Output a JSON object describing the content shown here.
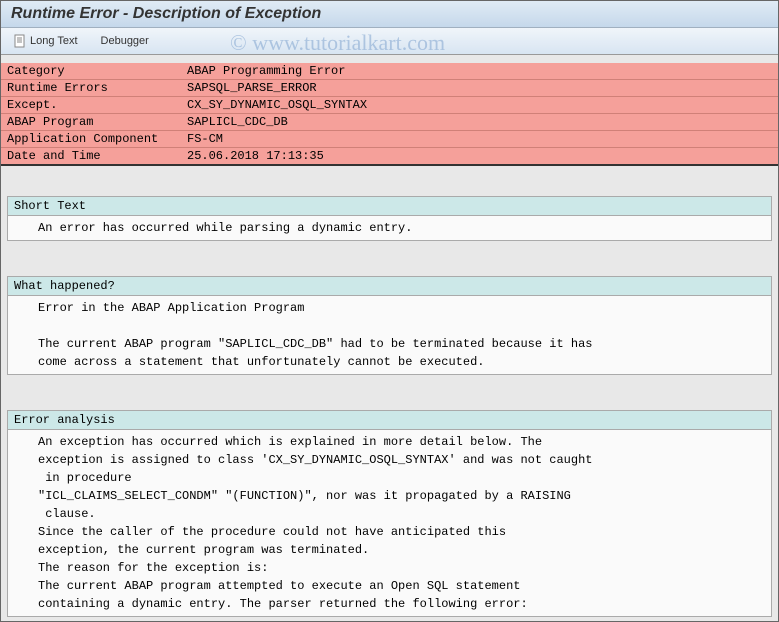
{
  "window": {
    "title": "Runtime Error - Description of Exception"
  },
  "toolbar": {
    "long_text": "Long Text",
    "debugger": "Debugger"
  },
  "info": {
    "category_label": "Category",
    "category_value": "ABAP Programming Error",
    "runtime_errors_label": "Runtime Errors",
    "runtime_errors_value": "SAPSQL_PARSE_ERROR",
    "except_label": "Except.",
    "except_value": "CX_SY_DYNAMIC_OSQL_SYNTAX",
    "abap_program_label": "ABAP Program",
    "abap_program_value": "SAPLICL_CDC_DB",
    "app_component_label": "Application Component",
    "app_component_value": "FS-CM",
    "datetime_label": "Date and Time",
    "datetime_value": "25.06.2018 17:13:35"
  },
  "sections": {
    "short_text": {
      "title": "Short Text",
      "body": "An error has occurred while parsing a dynamic entry."
    },
    "what_happened": {
      "title": "What happened?",
      "body": "Error in the ABAP Application Program\n\nThe current ABAP program \"SAPLICL_CDC_DB\" had to be terminated because it has\ncome across a statement that unfortunately cannot be executed."
    },
    "error_analysis": {
      "title": "Error analysis",
      "body": "An exception has occurred which is explained in more detail below. The\nexception is assigned to class 'CX_SY_DYNAMIC_OSQL_SYNTAX' and was not caught\n in procedure\n\"ICL_CLAIMS_SELECT_CONDM\" \"(FUNCTION)\", nor was it propagated by a RAISING\n clause.\nSince the caller of the procedure could not have anticipated this\nexception, the current program was terminated.\nThe reason for the exception is:\nThe current ABAP program attempted to execute an Open SQL statement\ncontaining a dynamic entry. The parser returned the following error:"
    }
  },
  "watermark": "© www.tutorialkart.com"
}
